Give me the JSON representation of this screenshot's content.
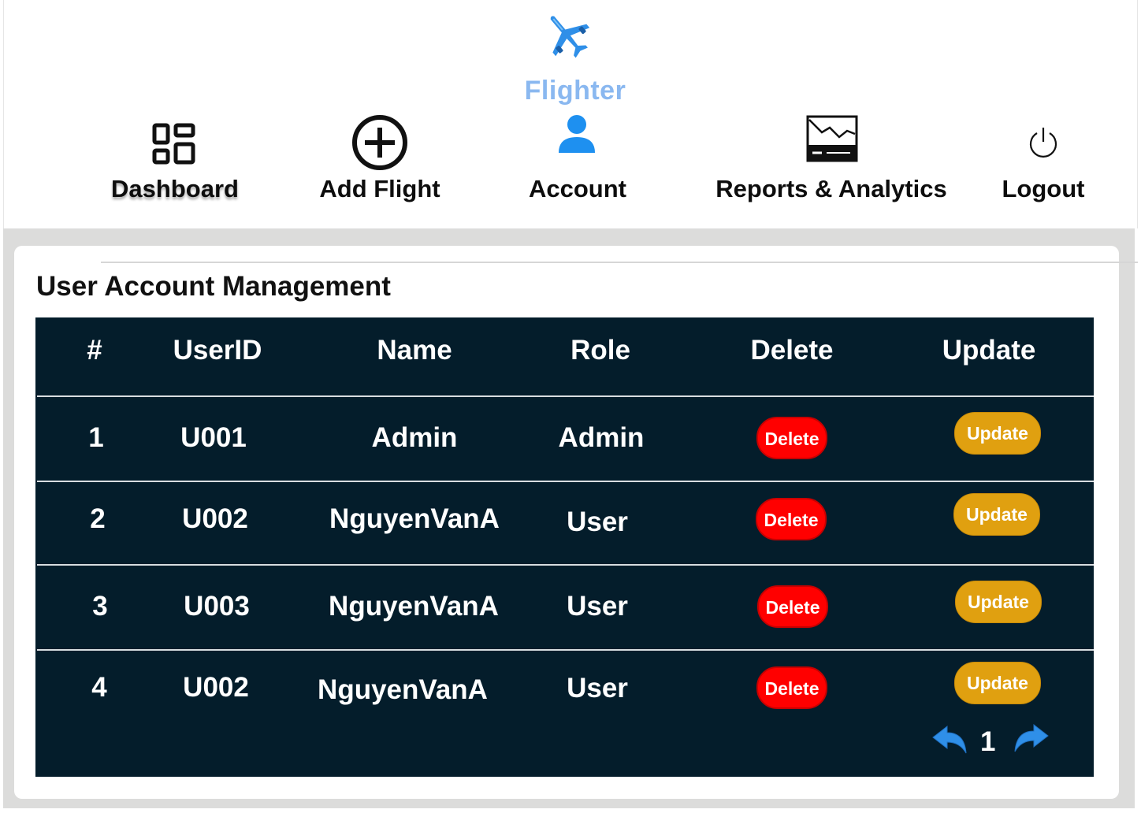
{
  "brand": {
    "name": "Flighter",
    "logo_icon": "airplane-icon",
    "color": "#8ab8f0"
  },
  "nav": {
    "dashboard": {
      "label": "Dashboard",
      "icon": "grid-icon"
    },
    "add_flight": {
      "label": "Add Flight",
      "icon": "plus-circle-icon"
    },
    "account": {
      "label": "Account",
      "icon": "user-icon"
    },
    "reports": {
      "label": "Reports & Analytics",
      "icon": "chart-icon"
    },
    "logout": {
      "label": "Logout",
      "icon": "power-icon"
    }
  },
  "page": {
    "title": "User Account Management"
  },
  "table": {
    "headers": [
      "#",
      "UserID",
      "Name",
      "Role",
      "Delete",
      "Update"
    ],
    "rows": [
      {
        "num": "1",
        "user_id": "U001",
        "name": "Admin",
        "role": "Admin",
        "delete": "Delete",
        "update": "Update"
      },
      {
        "num": "2",
        "user_id": "U002",
        "name": "NguyenVanA",
        "role": "User",
        "delete": "Delete",
        "update": "Update"
      },
      {
        "num": "3",
        "user_id": "U003",
        "name": "NguyenVanA",
        "role": "User",
        "delete": "Delete",
        "update": "Update"
      },
      {
        "num": "4",
        "user_id": "U002",
        "name": "NguyenVanA",
        "role": "User",
        "delete": "Delete",
        "update": "Update"
      }
    ]
  },
  "pagination": {
    "current_page": "1",
    "prev_icon": "arrow-back-icon",
    "next_icon": "arrow-forward-icon"
  },
  "colors": {
    "table_bg": "#041d2b",
    "delete_button": "#ff0000",
    "update_button": "#e0a010",
    "accent_blue": "#2f8fe8"
  }
}
